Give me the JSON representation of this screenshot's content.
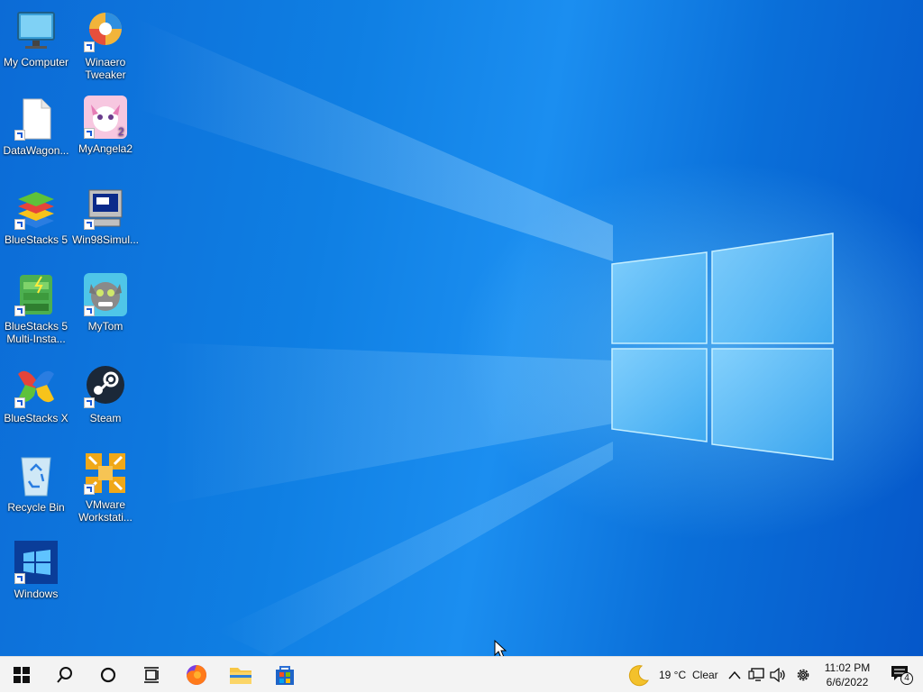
{
  "desktop": {
    "icons": [
      {
        "label": "My Computer",
        "icon": "monitor-icon"
      },
      {
        "label": "Winaero Tweaker",
        "icon": "winaero-tweaker-icon"
      },
      {
        "label": "DataWagon...",
        "icon": "blank-document-icon"
      },
      {
        "label": "MyAngela2",
        "icon": "my-angela-icon"
      },
      {
        "label": "BlueStacks 5",
        "icon": "bluestacks-icon"
      },
      {
        "label": "Win98Simul...",
        "icon": "win98-computer-icon"
      },
      {
        "label": "BlueStacks 5 Multi-Insta...",
        "icon": "bluestacks-multi-instance-icon"
      },
      {
        "label": "MyTom",
        "icon": "my-tom-icon"
      },
      {
        "label": "BlueStacks X",
        "icon": "bluestacks-x-icon"
      },
      {
        "label": "Steam",
        "icon": "steam-icon"
      },
      {
        "label": "Recycle Bin",
        "icon": "recycle-bin-icon"
      },
      {
        "label": "VMware Workstati...",
        "icon": "vmware-icon"
      },
      {
        "label": "Windows",
        "icon": "windows-logo-icon"
      }
    ]
  },
  "taskbar": {
    "buttons": [
      {
        "name": "start",
        "icon": "windows-start-icon"
      },
      {
        "name": "search",
        "icon": "search-icon"
      },
      {
        "name": "cortana",
        "icon": "cortana-circle-icon"
      },
      {
        "name": "task-view",
        "icon": "task-view-icon"
      },
      {
        "name": "firefox",
        "icon": "firefox-icon"
      },
      {
        "name": "file-explorer",
        "icon": "folder-icon"
      },
      {
        "name": "microsoft-store",
        "icon": "store-icon"
      }
    ],
    "weather": {
      "icon": "moon-icon",
      "temperature": "19 °C",
      "condition": "Clear"
    },
    "tray": {
      "icons": [
        "chevron-up-icon",
        "network-icon",
        "volume-icon",
        "settings-gear-icon"
      ]
    },
    "clock": {
      "time": "11:02 PM",
      "date": "6/6/2022"
    },
    "notifications": {
      "icon": "action-center-icon",
      "count": "4"
    }
  },
  "colors": {
    "accent": "#0f7fe3",
    "taskbar": "#f3f3f3"
  }
}
